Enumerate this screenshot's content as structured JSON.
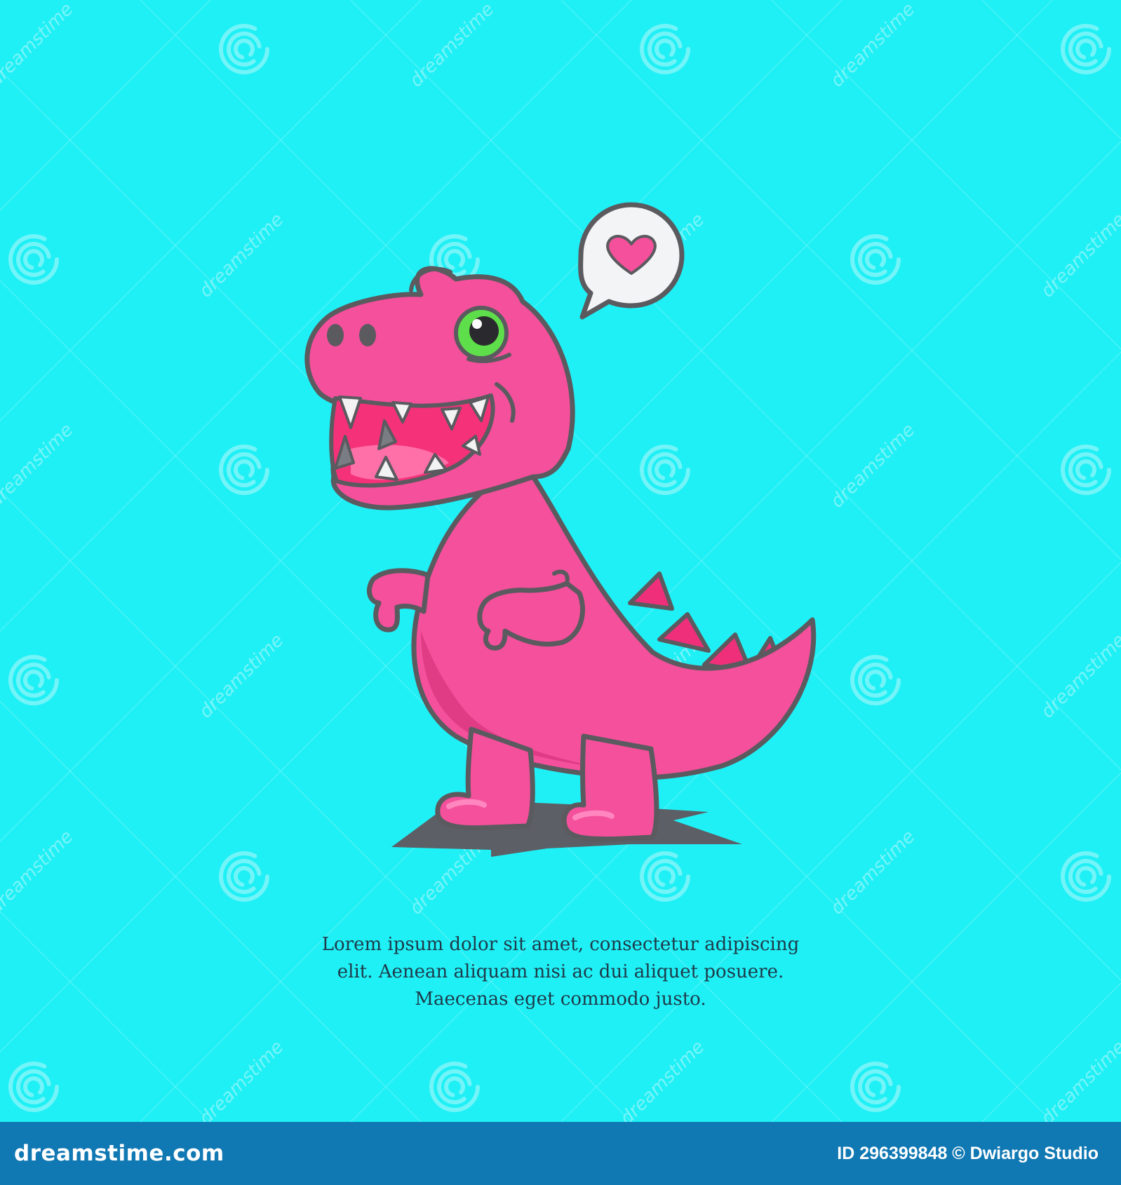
{
  "colors": {
    "background": "#1ff0f5",
    "footer": "#1078b3",
    "dino_body": "#f4509b",
    "dino_shade": "#e03c86",
    "outline": "#5a5a5f",
    "mouth": "#f5317a",
    "eye": "#5ede4a",
    "shadow": "#5c5f66",
    "bubble": "#f3f4f5",
    "heart": "#f4509b",
    "watermark": "#8ef6fa"
  },
  "watermark": {
    "text": "dreamstime"
  },
  "speech_bubble": {
    "icon": "heart-icon"
  },
  "caption": {
    "line1": "Lorem ipsum dolor sit amet, consectetur adipiscing",
    "line2": "elit. Aenean aliquam nisi ac dui aliquet posuere.",
    "line3": "Maecenas eget commodo justo."
  },
  "footer": {
    "brand": "dreamstime.com",
    "credit": "ID 296399848 © Dwiargo Studio"
  }
}
